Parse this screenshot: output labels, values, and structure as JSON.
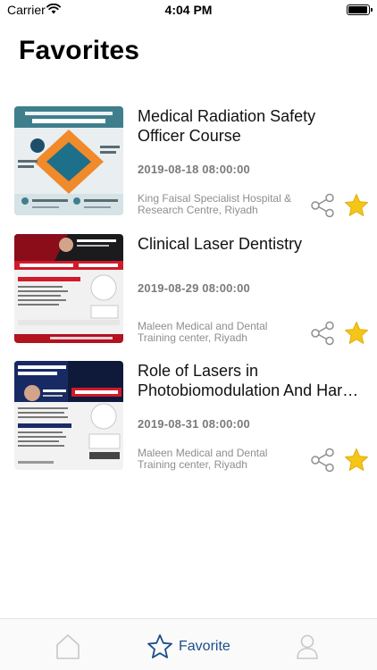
{
  "status_bar": {
    "carrier": "Carrier",
    "time": "4:04 PM"
  },
  "page": {
    "title": "Favorites"
  },
  "favorites": [
    {
      "title": "Medical Radiation Safety Officer Course",
      "date": "2019-08-18 08:00:00",
      "location": "King Faisal Specialist Hospital & Research Centre, Riyadh",
      "favorited": true
    },
    {
      "title": " Clinical Laser Dentistry",
      "date": "2019-08-29 08:00:00",
      "location": "Maleen Medical and Dental Training center, Riyadh",
      "favorited": true
    },
    {
      "title": "Role of Lasers in Photobiomodulation And Hard Tissues",
      "date": "2019-08-31 08:00:00",
      "location": "Maleen Medical and Dental Training center, Riyadh",
      "favorited": true
    }
  ],
  "tab_bar": {
    "items": [
      {
        "icon": "home-icon",
        "label": ""
      },
      {
        "icon": "star-outline-icon",
        "label": "Favorite",
        "active": true
      },
      {
        "icon": "person-icon",
        "label": ""
      }
    ],
    "active_color": "#1c4d8a",
    "inactive_color": "#c7c7cc"
  },
  "colors": {
    "star": "#f5c518",
    "share": "#8e8e93"
  }
}
